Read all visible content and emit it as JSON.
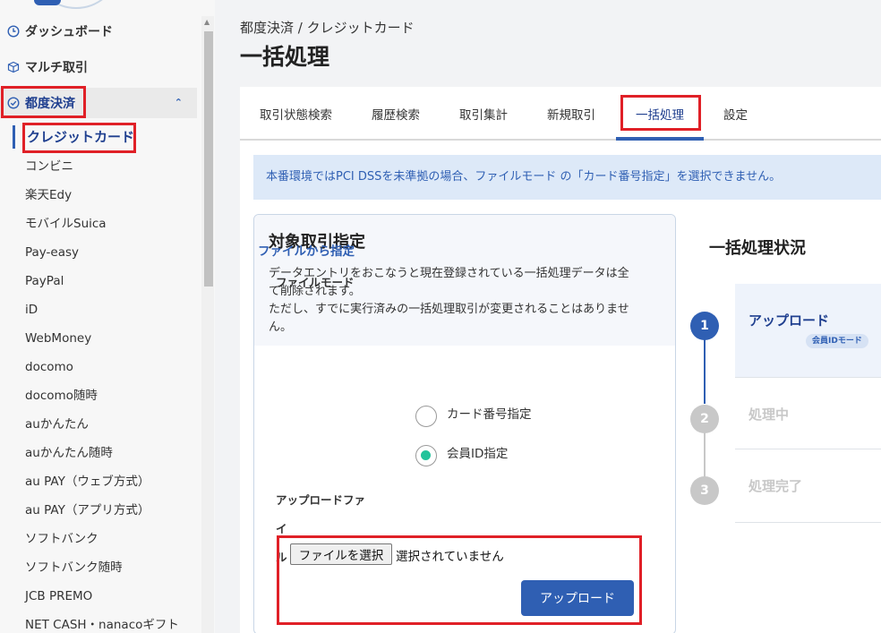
{
  "sidebar": {
    "top_items": [
      {
        "label": "ダッシュボード",
        "icon": "clock-icon"
      },
      {
        "label": "マルチ取引",
        "icon": "box-icon"
      },
      {
        "label": "都度決済",
        "icon": "check-circle-icon"
      }
    ],
    "sub_items": [
      "クレジットカード",
      "コンビニ",
      "楽天Edy",
      "モバイルSuica",
      "Pay-easy",
      "PayPal",
      "iD",
      "WebMoney",
      "docomo",
      "docomo随時",
      "auかんたん",
      "auかんたん随時",
      "au PAY（ウェブ方式）",
      "au PAY（アプリ方式）",
      "ソフトバンク",
      "ソフトバンク随時",
      "JCB PREMO",
      "NET CASH・nanacoギフト"
    ]
  },
  "header": {
    "breadcrumb": "都度決済 / クレジットカード",
    "title": "一括処理"
  },
  "tabs": [
    "取引状態検索",
    "履歴検索",
    "取引集計",
    "新規取引",
    "一括処理",
    "設定"
  ],
  "alert": "本番環境ではPCI DSSを未準拠の場合、ファイルモード の「カード番号指定」を選択できません。",
  "panel": {
    "title": "対象取引指定",
    "desc_line1": "データエントリをおこなうと現在登録されている一括処理データは全",
    "desc_line2": "て削除されます。",
    "desc_line3": "ただし、すでに実行済みの一括処理取引が変更されることはありませ",
    "desc_line4": "ん。",
    "file_section": "ファイルから指定",
    "file_mode_label": "ファイルモード",
    "radio_card": "カード番号指定",
    "radio_member": "会員ID指定",
    "upload_file_label_1": "アップロードファイ",
    "upload_file_label_2": "ル",
    "choose_file": "ファイルを選択",
    "no_file": "選択されていません",
    "upload_button": "アップロード"
  },
  "status": {
    "title": "一括処理状況",
    "steps": [
      {
        "num": "1",
        "label": "アップロード",
        "badge": "会員IDモード"
      },
      {
        "num": "2",
        "label": "処理中"
      },
      {
        "num": "3",
        "label": "処理完了"
      }
    ]
  },
  "colors": {
    "accent": "#2f5fb3",
    "highlight": "#e02027",
    "radio_on": "#22c39b",
    "inactive": "#c8c8c8"
  }
}
